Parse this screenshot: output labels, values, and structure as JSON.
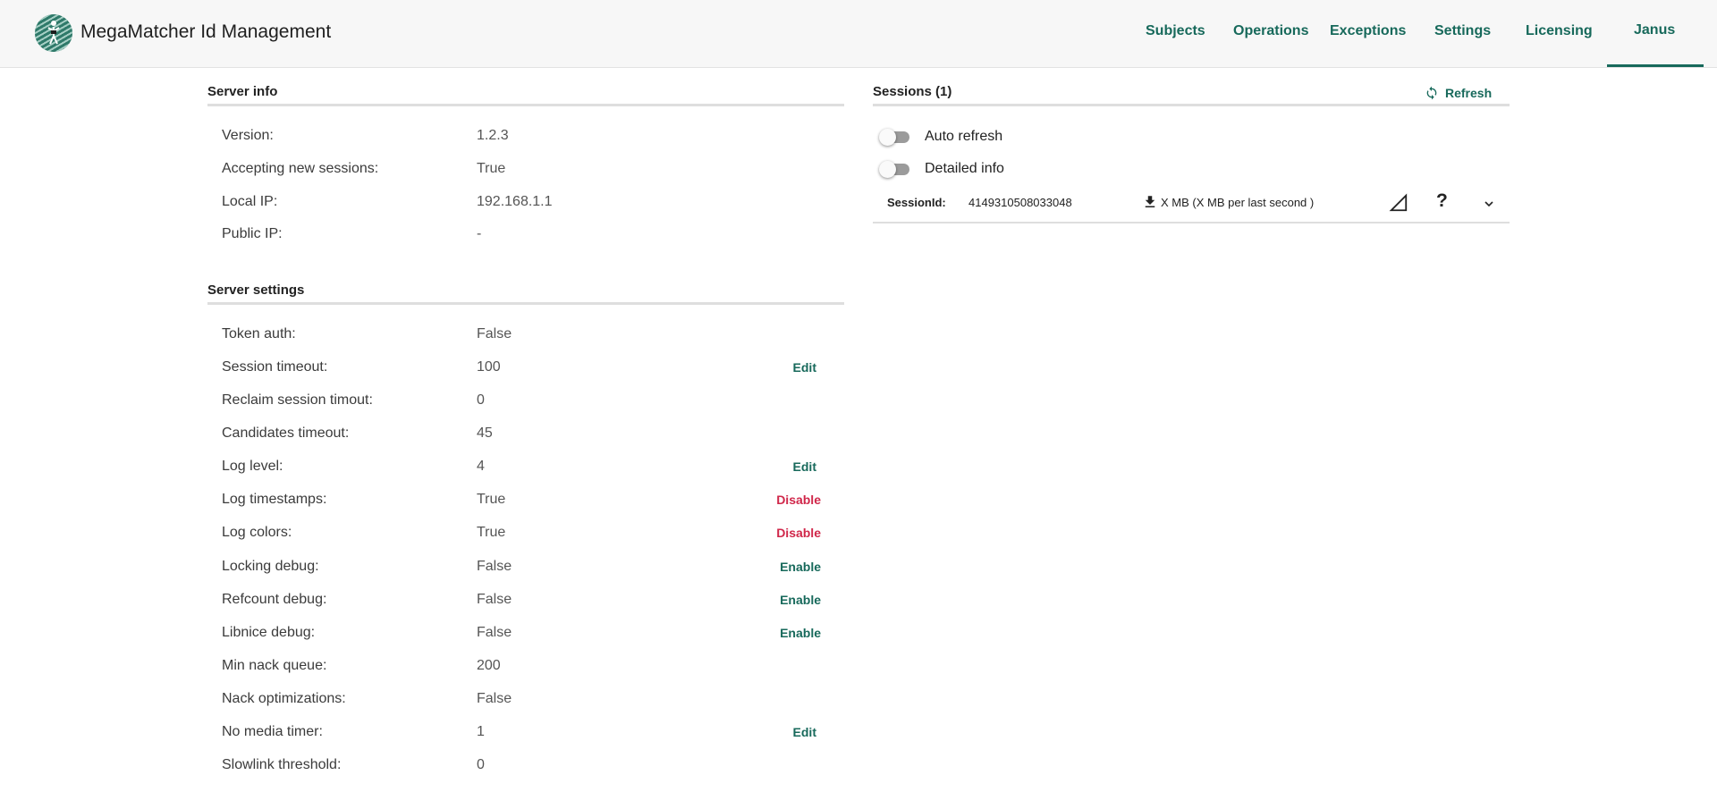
{
  "app": {
    "title": "MegaMatcher Id Management"
  },
  "nav": {
    "items": [
      "Subjects",
      "Operations",
      "Exceptions",
      "Settings",
      "Licensing",
      "Janus"
    ],
    "active": "Janus"
  },
  "server_info": {
    "title": "Server info",
    "rows": [
      {
        "label": "Version:",
        "value": "1.2.3"
      },
      {
        "label": "Accepting new sessions:",
        "value": "True"
      },
      {
        "label": "Local IP:",
        "value": "192.168.1.1"
      },
      {
        "label": "Public IP:",
        "value": "-"
      }
    ]
  },
  "server_settings": {
    "title": "Server settings",
    "rows": [
      {
        "label": "Token auth:",
        "value": "False",
        "action": ""
      },
      {
        "label": "Session timeout:",
        "value": "100",
        "action": "Edit"
      },
      {
        "label": "Reclaim session timout:",
        "value": "0",
        "action": ""
      },
      {
        "label": "Candidates timeout:",
        "value": "45",
        "action": ""
      },
      {
        "label": "Log level:",
        "value": "4",
        "action": "Edit"
      },
      {
        "label": "Log timestamps:",
        "value": "True",
        "action": "Disable"
      },
      {
        "label": "Log colors:",
        "value": "True",
        "action": "Disable"
      },
      {
        "label": "Locking debug:",
        "value": "False",
        "action": "Enable"
      },
      {
        "label": "Refcount debug:",
        "value": "False",
        "action": "Enable"
      },
      {
        "label": "Libnice debug:",
        "value": "False",
        "action": "Enable"
      },
      {
        "label": "Min nack queue:",
        "value": "200",
        "action": ""
      },
      {
        "label": "Nack optimizations:",
        "value": "False",
        "action": ""
      },
      {
        "label": "No media timer:",
        "value": "1",
        "action": "Edit"
      },
      {
        "label": "Slowlink threshold:",
        "value": "0",
        "action": ""
      }
    ]
  },
  "sessions": {
    "title": "Sessions (1)",
    "refresh_label": "Refresh",
    "auto_refresh_label": "Auto refresh",
    "auto_refresh_on": false,
    "detailed_info_label": "Detailed info",
    "detailed_info_on": false,
    "session": {
      "id_label": "SessionId:",
      "id_value": "4149310508033048",
      "transfer_text": "X MB (X MB per last second )",
      "help_symbol": "?"
    }
  },
  "colors": {
    "accent": "#17695b",
    "danger": "#d0274a",
    "header_bg": "#f7f7f7"
  }
}
